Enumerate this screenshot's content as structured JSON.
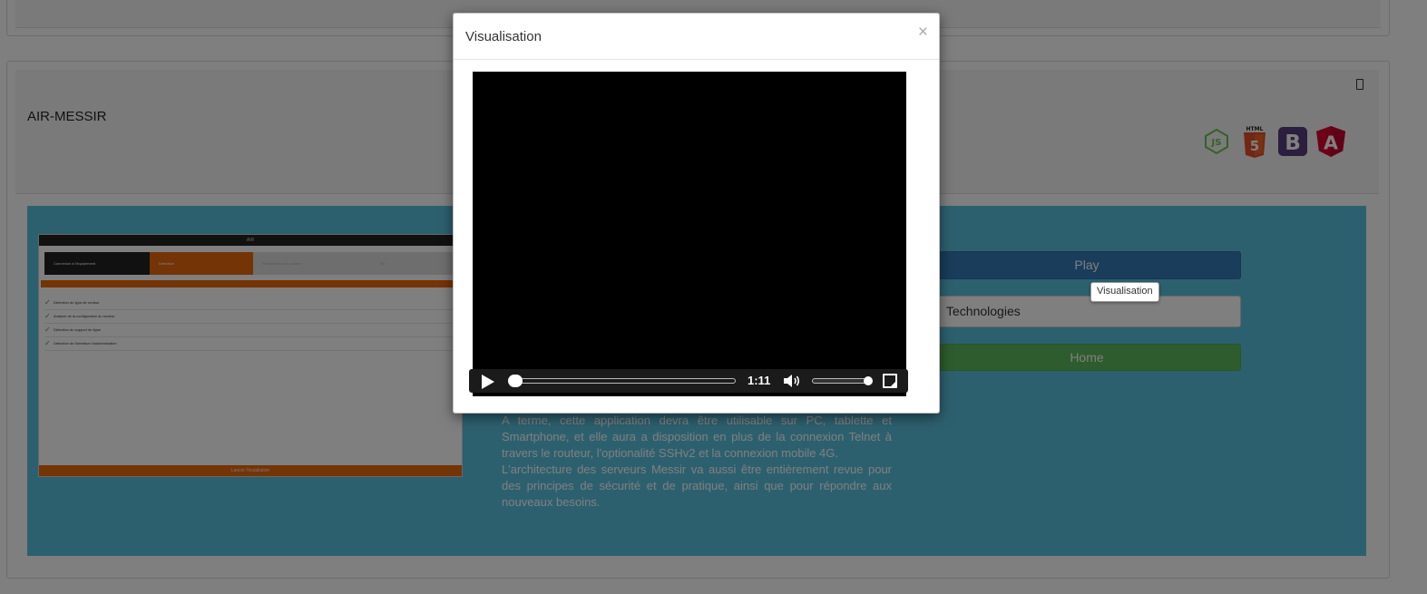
{
  "project": {
    "title": "AIR-MESSIR",
    "tech_icons": [
      "nodejs-icon",
      "html5-icon",
      "bootstrap-icon",
      "angular-icon"
    ]
  },
  "thumbnail": {
    "app_title": "AIR",
    "steps": [
      "Connexion à l'équipement",
      "Détection",
      "Récupération du routeur",
      "Fin"
    ],
    "checks": [
      "Détection du type de routeur",
      "Analyse de la configuration du routeur",
      "Détection du support de ligne",
      "Détection de l'interface d'administration"
    ],
    "footer": "Lancer l'installation"
  },
  "buttons": {
    "play": "Play",
    "technologies": "Technologies",
    "home": "Home"
  },
  "description": {
    "lines": [
      "A terme, cette application devra être utilisable sur PC, tablette et Smartphone, et elle aura a disposition en plus de la connexion Telnet à travers le routeur, l'optionalité SSHv2 et la connexion mobile 4G.",
      "L'architecture des serveurs Messir va aussi être entièrement revue pour des principes de sécurité et de pratique, ainsi que pour répondre aux nouveaux besoins."
    ]
  },
  "tooltip": {
    "text": "Visualisation"
  },
  "modal": {
    "title": "Visualisation",
    "close": "×",
    "video": {
      "time": "1:11",
      "progress_fraction": 0.02,
      "volume_fraction": 1.0
    }
  }
}
